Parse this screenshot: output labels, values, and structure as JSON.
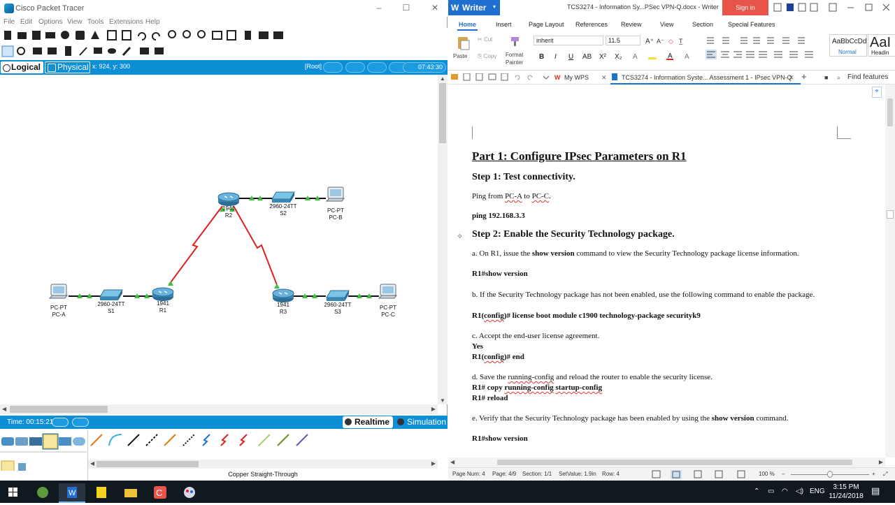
{
  "packet_tracer": {
    "title": "Cisco Packet Tracer",
    "menu": [
      "File",
      "Edit",
      "Options",
      "View",
      "Tools",
      "Extensions",
      "Help"
    ],
    "nav": {
      "logical": "Logical",
      "physical": "Physical",
      "coords": "x: 924, y: 300",
      "root": "[Root]",
      "clock": "07:43:30"
    },
    "devices": [
      {
        "id": "pca",
        "type": "pc",
        "label1": "PC-PT",
        "label2": "PC-A"
      },
      {
        "id": "s1",
        "type": "switch",
        "label1": "2960-24TT",
        "label2": "S1"
      },
      {
        "id": "r1",
        "type": "router",
        "label1": "1941",
        "label2": "R1"
      },
      {
        "id": "r2",
        "type": "router",
        "label1": "1941",
        "label2": "R2"
      },
      {
        "id": "s2",
        "type": "switch",
        "label1": "2960-24TT",
        "label2": "S2"
      },
      {
        "id": "pcb",
        "type": "pc",
        "label1": "PC-PT",
        "label2": "PC-B"
      },
      {
        "id": "r3",
        "type": "router",
        "label1": "1941",
        "label2": "R3"
      },
      {
        "id": "s3",
        "type": "switch",
        "label1": "2960-24TT",
        "label2": "S3"
      },
      {
        "id": "pcc",
        "type": "pc",
        "label1": "PC-PT",
        "label2": "PC-C"
      }
    ],
    "status": {
      "time": "Time: 00:15:21",
      "realtime": "Realtime",
      "simulation": "Simulation"
    },
    "cable_label": "Copper Straight-Through"
  },
  "writer": {
    "app_button": "Writer",
    "doc_title": "TCS3274 - Information Sy...PSec VPN-Q.docx - Writer",
    "signin": "Sign in",
    "tabs": [
      "Home",
      "Insert",
      "Page Layout",
      "References",
      "Review",
      "View",
      "Section",
      "Special Features"
    ],
    "ribbon": {
      "paste": "Paste",
      "cut": "Cut",
      "copy": "Copy",
      "format_painter_1": "Format",
      "format_painter_2": "Painter",
      "font": "inherit",
      "size": "11.5",
      "style_normal_sample": "AaBbCcDd",
      "style_normal": "Normal",
      "style_heading_sample": "AaI",
      "style_heading": "Headin"
    },
    "doc_tabs": {
      "mywps": "My WPS",
      "current": "TCS3274 - Information Syste... Assessment 1 - IPsec VPN-Q",
      "find": "Find features"
    },
    "content": {
      "part1": "Part 1: Configure IPsec Parameters on R1",
      "step1": "Step 1: Test connectivity.",
      "ping_text_a": "Ping from ",
      "ping_pca": "PC-A",
      "ping_text_b": " to ",
      "ping_pcc": "PC-C",
      "ping_text_c": ".",
      "ping_cmd": "ping 192.168.3.3",
      "step2": "Step 2: Enable the Security Technology package.",
      "a_text_1": "a.  On R1, issue the ",
      "a_bold": "show version",
      "a_text_2": " command to view the Security Technology package license information.",
      "a_cmd": "R1#show version",
      "b_text": "b.  If the Security Technology package has not been enabled, use the following command to enable the package.",
      "b_cmd_1": "R1(",
      "b_cmd_config": "config",
      "b_cmd_2": ")# license boot module c1900 technology-package securityk9",
      "c_text": "c.  Accept the end-user license agreement.",
      "c_yes": "Yes",
      "c_cmd_1": "R1(",
      "c_cmd_config": "config",
      "c_cmd_2": ")# end",
      "d_text_1": "d.  Save the ",
      "d_running": "running-config",
      "d_text_2": " and reload the router to enable the security license.",
      "d_cmd_1": "R1# copy ",
      "d_cmd_running": "running-config",
      "d_cmd_space": " ",
      "d_cmd_startup": "startup-config",
      "d_cmd_2": "R1# reload",
      "e_text_1": "e.  Verify that the Security Technology package has been enabled by using the ",
      "e_bold": "show version",
      "e_text_2": " command.",
      "e_cmd": "R1#show version"
    },
    "status": {
      "page_num": "Page Num: 4",
      "page": "Page: 4/9",
      "section": "Section: 1/1",
      "setvalue": "SetValue: 1.9in",
      "row": "Row: 4",
      "zoom": "100 %"
    }
  },
  "taskbar": {
    "lang": "ENG",
    "time": "3:15 PM",
    "date": "11/24/2018"
  },
  "colors": {
    "pt_blue": "#0d8fd6",
    "writer_blue": "#1e6fd0",
    "signin_red": "#e8534a",
    "serial_link": "#e02020",
    "link_green": "#3cc13c"
  }
}
